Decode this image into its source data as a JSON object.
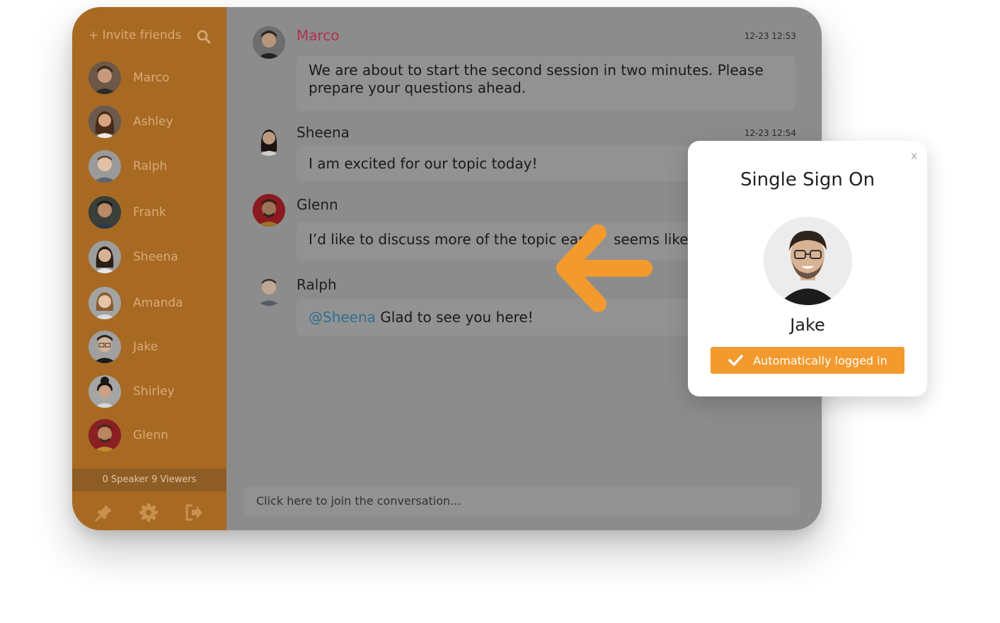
{
  "sidebar": {
    "invite_label": "+ Invite friends",
    "users": [
      {
        "name": "Marco",
        "skin": "#c69a7a",
        "hair": "#3a2a1f"
      },
      {
        "name": "Ashley",
        "skin": "#d4a37f",
        "hair": "#4a2b1a"
      },
      {
        "name": "Ralph",
        "skin": "#e3c1a4",
        "hair": "#5a4030"
      },
      {
        "name": "Frank",
        "skin": "#b88a65",
        "hair": "#1e1a18"
      },
      {
        "name": "Sheena",
        "skin": "#d8b294",
        "hair": "#2a1d16"
      },
      {
        "name": "Amanda",
        "skin": "#e5c4a8",
        "hair": "#8a5a30"
      },
      {
        "name": "Jake",
        "skin": "#d7b293",
        "hair": "#2f231b"
      },
      {
        "name": "Shirley",
        "skin": "#caa184",
        "hair": "#1f1714"
      },
      {
        "name": "Glenn",
        "skin": "#b98660",
        "hair": "#3b2c22"
      }
    ],
    "count_label": "0 Speaker 9 Viewers"
  },
  "messages": [
    {
      "author": "Marco",
      "time": "12-23 12:53",
      "text_line1": "We are about to start the second session in two minutes. Please",
      "text_line2": "prepare your questions ahead."
    },
    {
      "author": "Sheena",
      "time": "12-23 12:54",
      "text": "I am excited for our topic today!"
    },
    {
      "author": "Glenn",
      "text": "I’d like to discuss more of the topic earl",
      "text_tail": "seems like c"
    },
    {
      "author": "Ralph",
      "mention": "@Sheena",
      "text": " Glad to see you here!"
    }
  ],
  "composer": {
    "placeholder": "Click here to join the conversation..."
  },
  "modal": {
    "close": "x",
    "title": "Single Sign On",
    "user_name": "Jake",
    "status_button": "Automatically logged in"
  },
  "colors": {
    "sidebar": "#a86a22",
    "accent": "#f29a2e",
    "author_highlight": "#b0324f",
    "mention": "#2f6f94"
  }
}
